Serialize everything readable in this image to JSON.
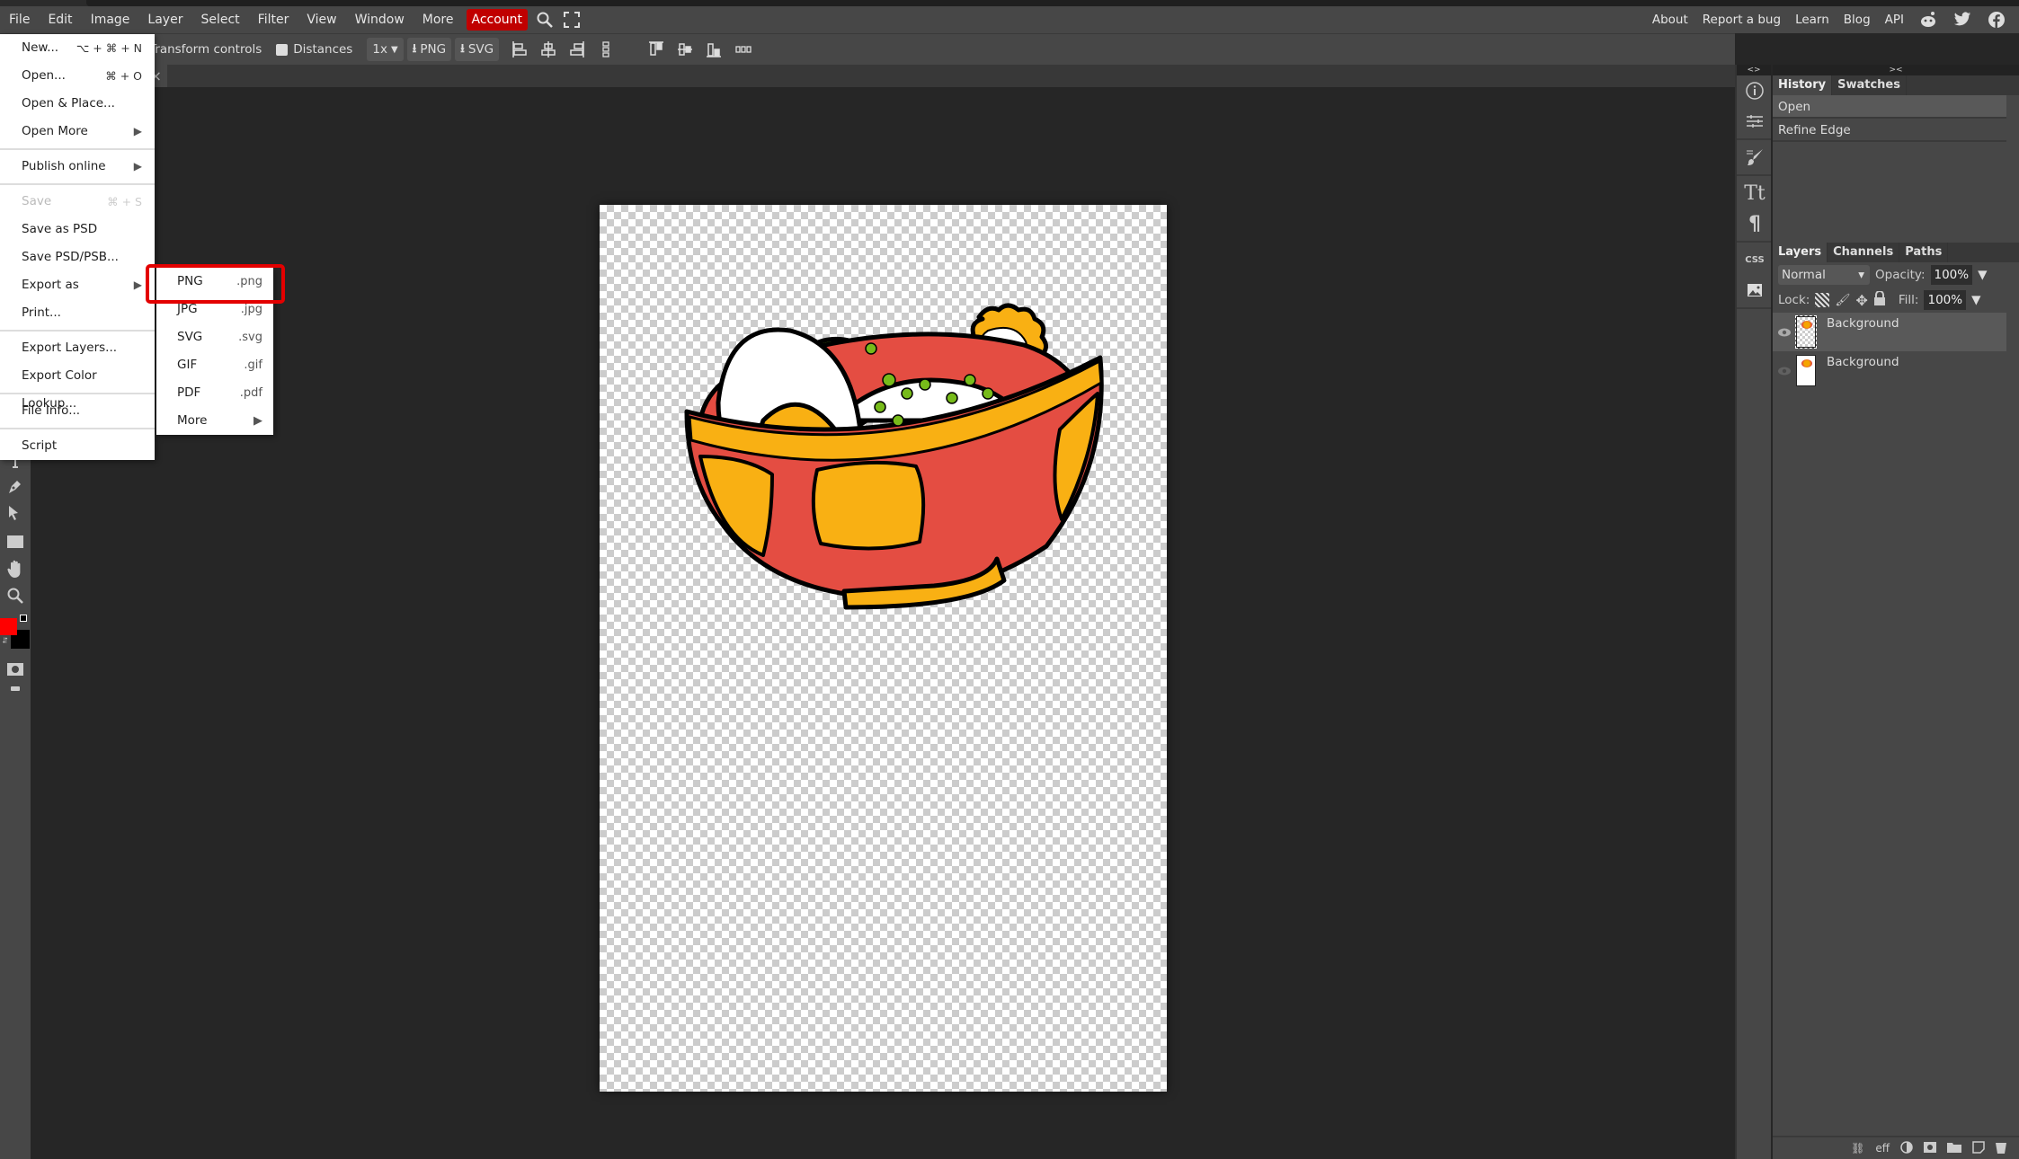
{
  "menubar": {
    "items": [
      "File",
      "Edit",
      "Image",
      "Layer",
      "Select",
      "Filter",
      "View",
      "Window",
      "More"
    ],
    "account": "Account",
    "right_links": [
      "About",
      "Report a bug",
      "Learn",
      "Blog",
      "API"
    ],
    "social_icons": [
      "reddit-icon",
      "twitter-icon",
      "facebook-icon"
    ]
  },
  "options": {
    "transform_label": "Transform controls",
    "distances_label": "Distances",
    "scale": "1x",
    "png_btn": "PNG",
    "svg_btn": "SVG"
  },
  "document_tab": {
    "close": "×"
  },
  "file_menu": {
    "items": [
      {
        "label": "New...",
        "shortcut": "⌥ + ⌘ + N"
      },
      {
        "label": "Open...",
        "shortcut": "⌘ + O"
      },
      {
        "label": "Open & Place..."
      },
      {
        "label": "Open More",
        "submenu": true
      },
      {
        "label": "Publish online",
        "submenu": true
      },
      {
        "label": "Save",
        "shortcut": "⌘ + S",
        "disabled": true
      },
      {
        "label": "Save as PSD"
      },
      {
        "label": "Save PSD/PSB..."
      },
      {
        "label": "Export as",
        "submenu": true
      },
      {
        "label": "Print..."
      },
      {
        "label": "Export Layers..."
      },
      {
        "label": "Export Color Lookup..."
      },
      {
        "label": "File Info..."
      },
      {
        "label": "Script"
      }
    ],
    "arrow": "▶"
  },
  "export_submenu": {
    "items": [
      {
        "label": "PNG",
        "ext": ".png",
        "highlighted": true
      },
      {
        "label": "JPG",
        "ext": ".jpg"
      },
      {
        "label": "SVG",
        "ext": ".svg"
      },
      {
        "label": "GIF",
        "ext": ".gif"
      },
      {
        "label": "PDF",
        "ext": ".pdf"
      },
      {
        "label": "More",
        "ext": "▶"
      }
    ],
    "highlight_color": "#e30000"
  },
  "right_icons": {
    "collapse": "<>",
    "css": "CSS"
  },
  "history_panel": {
    "collapse": "><",
    "tabs": [
      "History",
      "Swatches"
    ],
    "entries": [
      "Open",
      "Refine Edge"
    ]
  },
  "layers_panel": {
    "tabs": [
      "Layers",
      "Channels",
      "Paths"
    ],
    "blend_mode": "Normal",
    "opacity_label": "Opacity:",
    "opacity": "100%",
    "lock_label": "Lock:",
    "fill_label": "Fill:",
    "fill": "100%",
    "layers": [
      {
        "name": "Background",
        "selected": true,
        "visible": true
      },
      {
        "name": "Background",
        "selected": false,
        "visible": false
      }
    ],
    "footer": {
      "eff": "eff"
    }
  },
  "colors": {
    "foreground": "#ff0000",
    "background": "#000000",
    "account_bg": "#c00000"
  }
}
